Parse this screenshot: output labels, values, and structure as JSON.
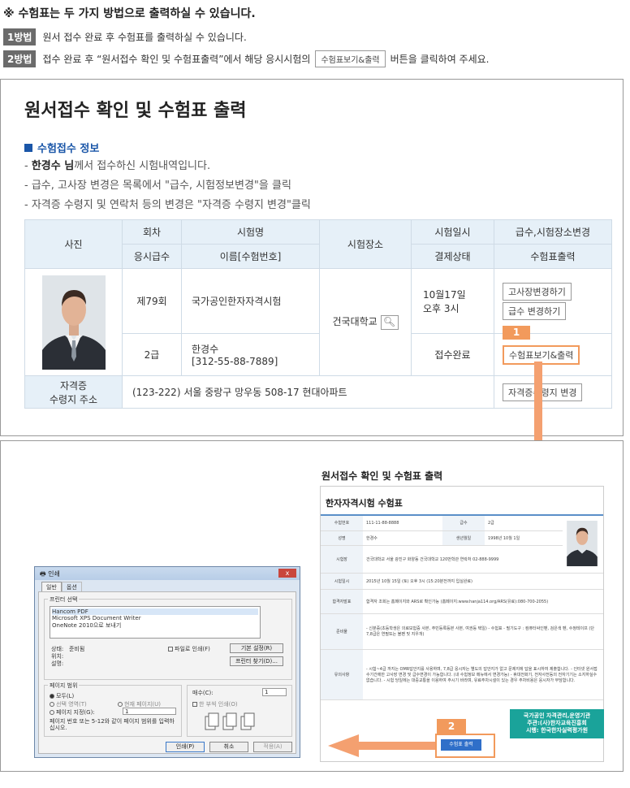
{
  "notice": {
    "title": "※ 수험표는 두 가지 방법으로 출력하실 수 있습니다.",
    "method1_badge": "1방법",
    "method1_text": "원서 접수 완료 후 수험표를 출력하실 수 있습니다.",
    "method2_badge": "2방법",
    "method2_text_pre": "접수 완료 후 “원서접수 확인 및 수험표출력”에서 해당 응시시험의",
    "method2_button": "수험표보기&출력",
    "method2_text_post": "버튼을 클릭하여 주세요."
  },
  "panel1": {
    "title": "원서접수 확인 및 수험표 출력",
    "section_heading": "수험접수 정보",
    "desc1_name": "한경수 님",
    "desc1_rest": "께서 접수하신 시험내역입니다.",
    "desc1_prefix": "- ",
    "desc2": "- 급수, 고사장 변경은 목록에서 \"급수, 시험정보변경\"을 클릭",
    "desc3": "- 자격증 수령지 및 연락처 등의 변경은 \"자격증 수령지 변경\"클릭",
    "table": {
      "h_photo": "사진",
      "h_round": "회차",
      "h_exam": "시험명",
      "h_place": "시험장소",
      "h_date": "시험일시",
      "h_change": "급수,시험장소변경",
      "h_grade": "응시급수",
      "h_name": "이름[수험번호]",
      "h_pay": "결제상태",
      "h_print": "수험표출력",
      "round": "제79회",
      "exam": "국가공인한자자격시험",
      "place": "건국대학교",
      "date_line1": "10월17일",
      "date_line2": "오후 3시",
      "btn_change_place": "고사장변경하기",
      "btn_change_grade": "급수 변경하기",
      "grade": "2급",
      "name": "한경수",
      "number": "[312-55-88-7889]",
      "pay_status": "접수완료",
      "btn_print": "수험표보기&출력",
      "addr_label1": "자격증",
      "addr_label2": "수령지 주소",
      "address": "(123-222) 서울 중랑구 망우동 508-17 현대아파트",
      "btn_addr": "자격증수령지 변경"
    },
    "marker": "1"
  },
  "panel2": {
    "title": "원서접수 확인 및 수험표 출력",
    "ticket": {
      "heading": "한자자격시험 수험표",
      "rows": [
        {
          "label": "수험번호",
          "value": "111-11-88-8888",
          "label2": "급수",
          "value2": "2급"
        },
        {
          "label": "성명",
          "value": "한경수",
          "label2": "생년월일",
          "value2": "1998년 10월 1일"
        },
        {
          "label": "시험장",
          "value": "건국대학교 서울 광진구 화양동 건국대학교 120번학관 연락처 02-888-9999"
        },
        {
          "label": "시험일시",
          "value": "2015년 10월 15일 (토) 오후 3시 (15:20분전까지 입실완료)"
        },
        {
          "label": "합격자발표",
          "value": "합격자 조회는 홈페이지와 ARS로 확인가능 (홈페이지:www.hanja114.org/ARS(유료):080-700-2055)"
        },
        {
          "label": "준비물",
          "value": "- 신분증(초등학생은 의료보험증 사본, 주민등록등본 사본, 여권등 택일) - 수험표 - 필기도구 : 컴퓨터싸인펜, 검은색 펜, 수정테이프 (단 7,8급은 연필또는 볼펜 및 지우개)"
        },
        {
          "label": "유의사항",
          "value": "- 시험~4급 까지는 OMR답안지를 사용하며, 7,8급 응시자는 별도의 답안지가 없고 문제지에 답을 표시하여 제출합니다. - 인터넷 원서접수기간에만 고사장 변경 및 급수변경이 가능합니다. (내 수험정보 메뉴에서 변경가능) - 휴대전화기, 전자사전등의 전자기기는 소지하실수 없습니다. - 시험 당일에는 대중교통을 이용하여 주시기 바라며, 유료주차시설이 있는 경우 주차비용은 응시자가 부담합니다."
        }
      ],
      "org_line1": "국가공인 자격관리,운영기관",
      "org_line2": "주관:(사)한자교육진흥회",
      "org_line3": "시행: 한국한자실력평가원",
      "print_btn": "수험표 출력"
    },
    "marker": "2",
    "dialog": {
      "title": "인쇄",
      "close": "x",
      "tab_general": "일반",
      "tab_options": "옵션",
      "printer_select": "프린터 선택",
      "printers": [
        "Hancom PDF",
        "Microsoft XPS Document Writer",
        "OneNote 2010으로 보내기"
      ],
      "status_label": "상태:",
      "status_value": "준비됨",
      "location_label": "위치:",
      "comment_label": "설명:",
      "print_to_file": "파일로 인쇄(F)",
      "preferences": "기본 설정(R)",
      "find_printer": "프린터 찾기(D)...",
      "page_range": "페이지 범위",
      "all": "모두(L)",
      "selection": "선택 영역(T)",
      "current_page": "현재 페이지(U)",
      "pages": "페이지 지정(G):",
      "pages_value": "1",
      "range_hint": "페이지 번호 또는 5-12와 같이 페이지 범위를 입력하십시오.",
      "copies": "매수(C):",
      "copies_value": "1",
      "collate": "한 부씩 인쇄(O)",
      "btn_print": "인쇄(P)",
      "btn_cancel": "취소",
      "btn_apply": "적용(A)"
    }
  },
  "colors": {
    "accent_blue": "#1a56a8",
    "marker_orange": "#f29a5c",
    "status_red": "#e01010",
    "header_bg": "#e6f0f8"
  }
}
